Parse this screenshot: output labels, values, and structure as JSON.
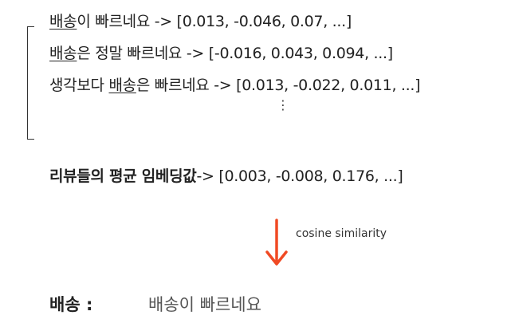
{
  "examples": [
    {
      "keyword": "배송",
      "rest": "이 빠르네요 -> [0.013, -0.046, 0.07, ...]"
    },
    {
      "keyword": "배송",
      "rest": "은 정말 빠르네요 -> [-0.016, 0.043, 0.094, ...]"
    },
    {
      "prefix": "생각보다 ",
      "keyword": "배송",
      "rest": "은 빠르네요 -> [0.013, -0.022, 0.011, ...]"
    }
  ],
  "ellipsis": "⋮",
  "average": {
    "label": "리뷰들의 평균 임베딩값",
    "value": "-> [0.003, -0.008, 0.176, ...]"
  },
  "arrow": {
    "label": "cosine similarity",
    "color": "#f04a24"
  },
  "result": {
    "label": "배송 :",
    "text": "배송이 빠르네요"
  }
}
